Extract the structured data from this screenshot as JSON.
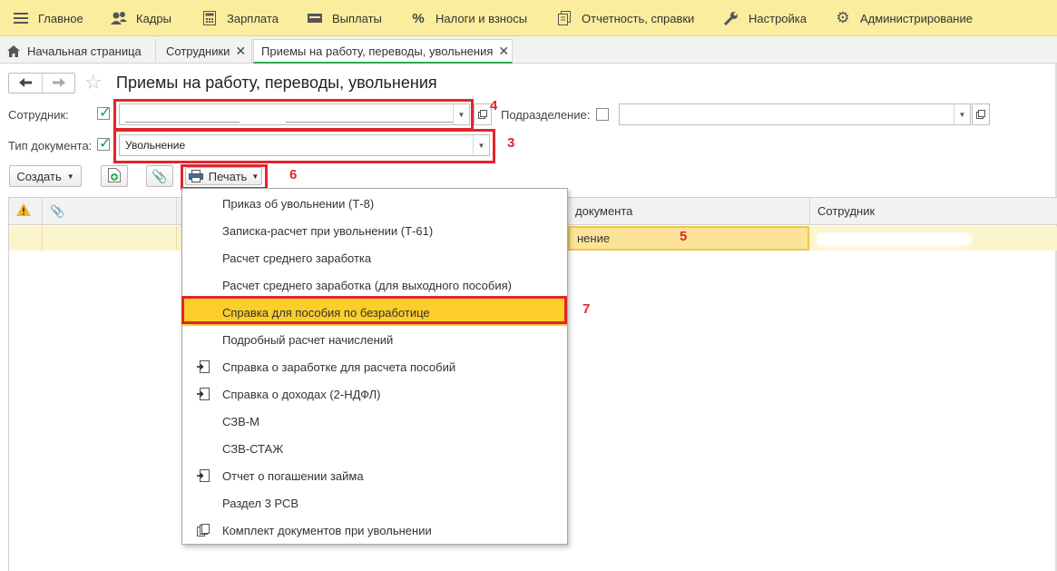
{
  "topmenu": [
    {
      "label": "Главное",
      "icon": "hamburger-icon"
    },
    {
      "label": "Кадры",
      "icon": "people-icon"
    },
    {
      "label": "Зарплата",
      "icon": "calculator-icon"
    },
    {
      "label": "Выплаты",
      "icon": "wallet-icon"
    },
    {
      "label": "Налоги и взносы",
      "icon": "percent-icon"
    },
    {
      "label": "Отчетность, справки",
      "icon": "reports-icon"
    },
    {
      "label": "Настройка",
      "icon": "wrench-icon"
    },
    {
      "label": "Администрирование",
      "icon": "gear-icon"
    }
  ],
  "tabs": [
    {
      "label": "Начальная страница",
      "icon": "home-icon",
      "closable": false
    },
    {
      "label": "Сотрудники",
      "closable": true
    },
    {
      "label": "Приемы на работу, переводы, увольнения",
      "closable": true,
      "active": true
    }
  ],
  "header": {
    "title": "Приемы на работу, переводы, увольнения"
  },
  "filters": {
    "employee_label": "Сотрудник:",
    "employee_value": "",
    "department_label": "Подразделение:",
    "department_value": "",
    "doctype_label": "Тип документа:",
    "doctype_value": "Увольнение"
  },
  "toolbar": {
    "create_label": "Создать",
    "print_label": "Печать"
  },
  "table": {
    "columns": [
      "",
      "",
      "",
      "документа",
      "Сотрудник"
    ],
    "rows": [
      {
        "doc_type": "нение",
        "employee": ""
      }
    ]
  },
  "print_menu": [
    {
      "label": "Приказ об увольнении (Т-8)",
      "icon": ""
    },
    {
      "label": "Записка-расчет при увольнении (Т-61)",
      "icon": ""
    },
    {
      "label": "Расчет среднего заработка",
      "icon": ""
    },
    {
      "label": "Расчет среднего заработка (для выходного пособия)",
      "icon": ""
    },
    {
      "label": "Справка для пособия по безработице",
      "icon": "",
      "highlighted": true
    },
    {
      "label": "Подробный расчет начислений",
      "icon": ""
    },
    {
      "label": "Справка о заработке для расчета пособий",
      "icon": "export-doc-icon"
    },
    {
      "label": "Справка о доходах (2-НДФЛ)",
      "icon": "export-doc-icon"
    },
    {
      "label": "СЗВ-М",
      "icon": ""
    },
    {
      "label": "СЗВ-СТАЖ",
      "icon": ""
    },
    {
      "label": "Отчет о погашении займа",
      "icon": "export-doc-icon"
    },
    {
      "label": "Раздел 3 РСВ",
      "icon": ""
    },
    {
      "label": "Комплект документов при увольнении",
      "icon": "doc-set-icon"
    }
  ],
  "annotations": [
    "4",
    "3",
    "6",
    "5",
    "7"
  ],
  "colors": {
    "menu_bg": "#fbed9e",
    "highlight": "#fbce2a",
    "annotation_red": "#e0262b",
    "row_selected": "#fcf4cc",
    "check_green": "#1a9c3e"
  }
}
